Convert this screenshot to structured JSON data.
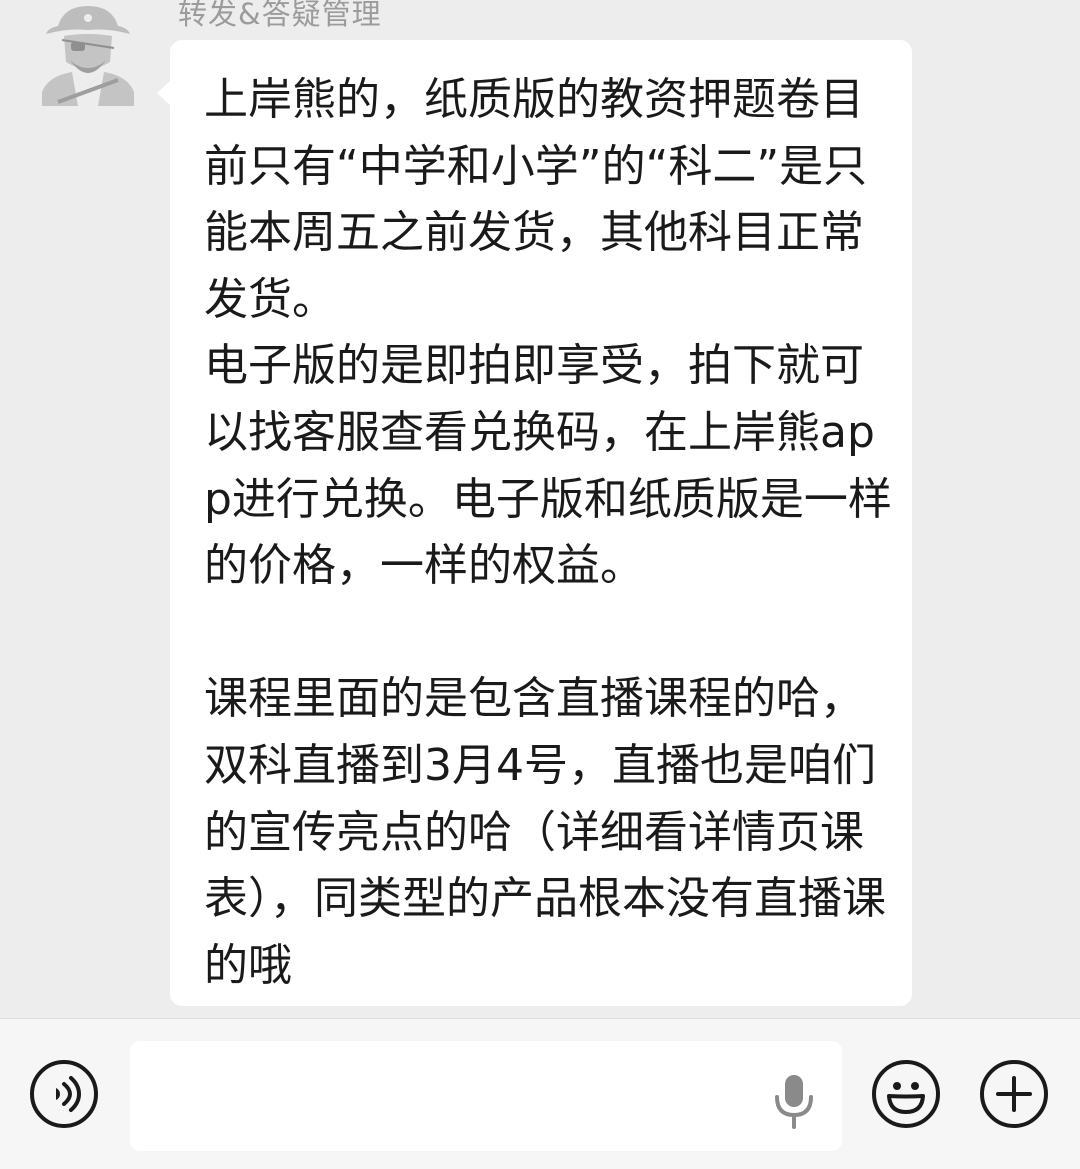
{
  "chat": {
    "sender_name": "转发&答疑管理",
    "avatar_icon": "pirate-avatar-icon",
    "message_text": "上岸熊的，纸质版的教资押题卷目前只有“中学和小学”的“科二”是只能本周五之前发货，其他科目正常发货。\n电子版的是即拍即享受，拍下就可以找客服查看兑换码，在上岸熊app进行兑换。电子版和纸质版是一样的价格，一样的权益。\n\n课程里面的是包含直播课程的哈，双科直播到3月4号，直播也是咱们的宣传亮点的哈（详细看详情页课表），同类型的产品根本没有直播课的哦"
  },
  "input_bar": {
    "voice_icon": "voice-toggle-icon",
    "mic_icon": "microphone-icon",
    "emoji_icon": "emoji-icon",
    "plus_icon": "plus-icon",
    "text_value": ""
  }
}
